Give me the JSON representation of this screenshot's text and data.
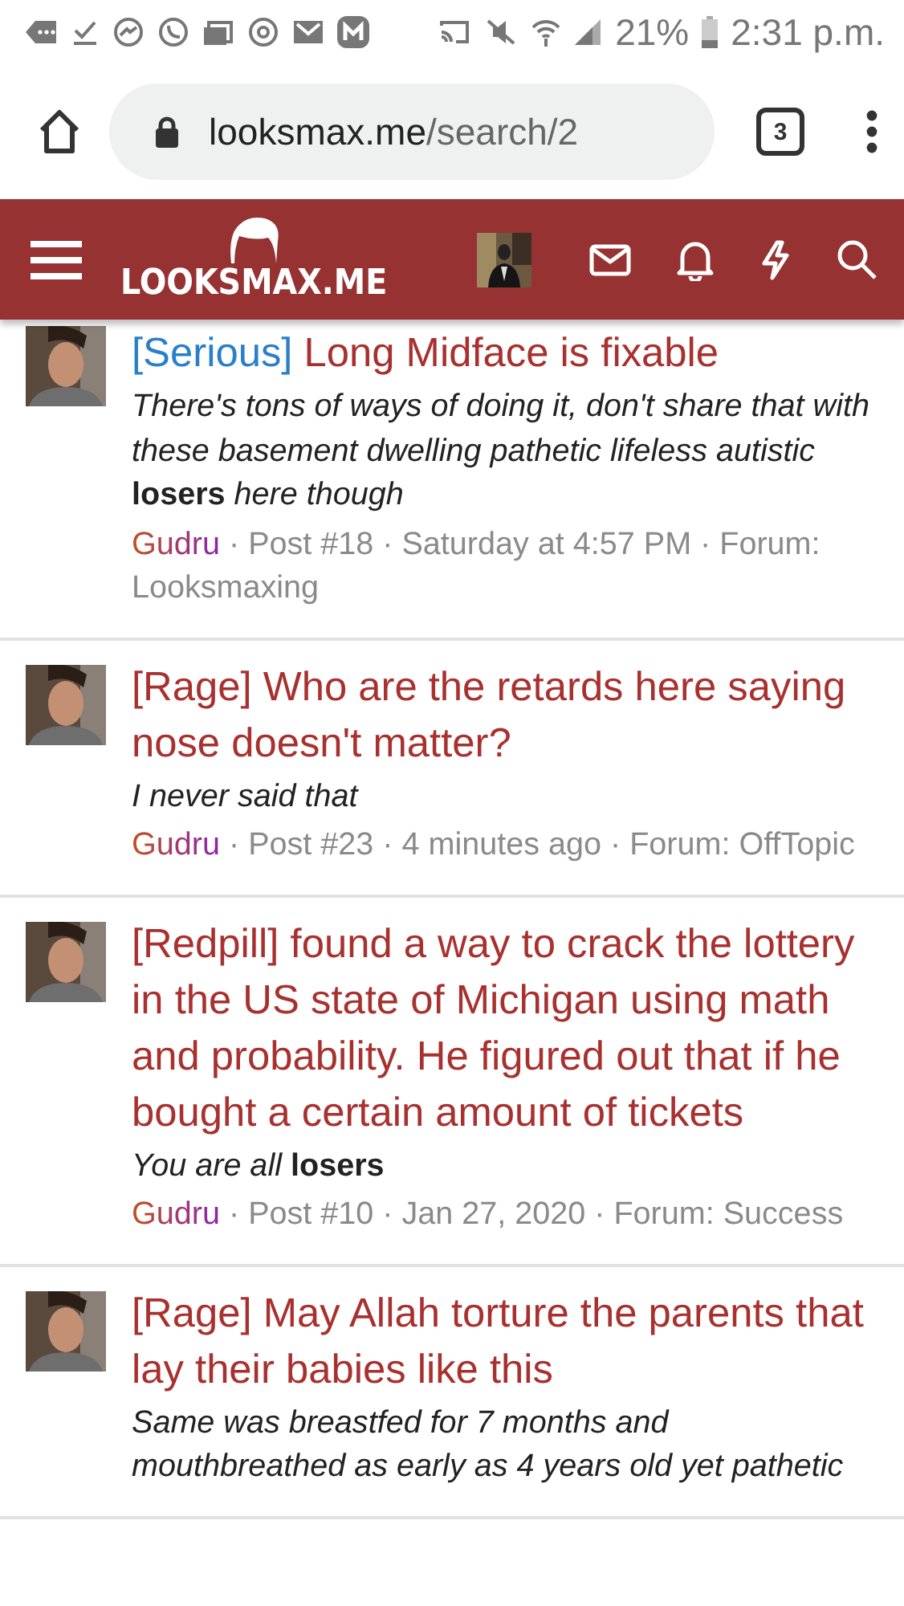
{
  "status_bar": {
    "battery": "21%",
    "time": "2:31 p.m."
  },
  "browser": {
    "url_host": "looksmax.me",
    "url_path": "/search/2",
    "tab_count": "3"
  },
  "site_header": {
    "logo": "LOOKSMAX.ME"
  },
  "results": [
    {
      "prefix": {
        "label": "[Serious]",
        "color": "#2a7fc9"
      },
      "title": "Long Midface is fixable",
      "snippet": "There's tons of ways of doing it, don't share that with these basement dwelling pathetic lifeless autistic **losers** here though",
      "author": "Gudru",
      "meta": "· Post #18 · Saturday at 4:57 PM · Forum: Looksmaxing"
    },
    {
      "prefix": {
        "label": "[Rage]",
        "color": "#a8312f"
      },
      "title": "Who are the retards here saying nose doesn't matter?",
      "snippet": "I never said that",
      "author": "Gudru",
      "meta": "· Post #23 · 4 minutes ago · Forum: OffTopic"
    },
    {
      "prefix": {
        "label": "[Redpill]",
        "color": "#a8312f"
      },
      "title": "found a way to crack the lottery in the US state of Michigan using math and probability. He figured out that if he bought a certain amount of tickets",
      "snippet": "You are all **losers**",
      "author": "Gudru",
      "meta": "· Post #10 · Jan 27, 2020 · Forum: Success"
    },
    {
      "prefix": {
        "label": "[Rage]",
        "color": "#a8312f"
      },
      "title": "May Allah torture the parents that lay their babies like this",
      "snippet": "Same was breastfed for 7 months and mouthbreathed as early as 4 years old yet pathetic"
    }
  ]
}
